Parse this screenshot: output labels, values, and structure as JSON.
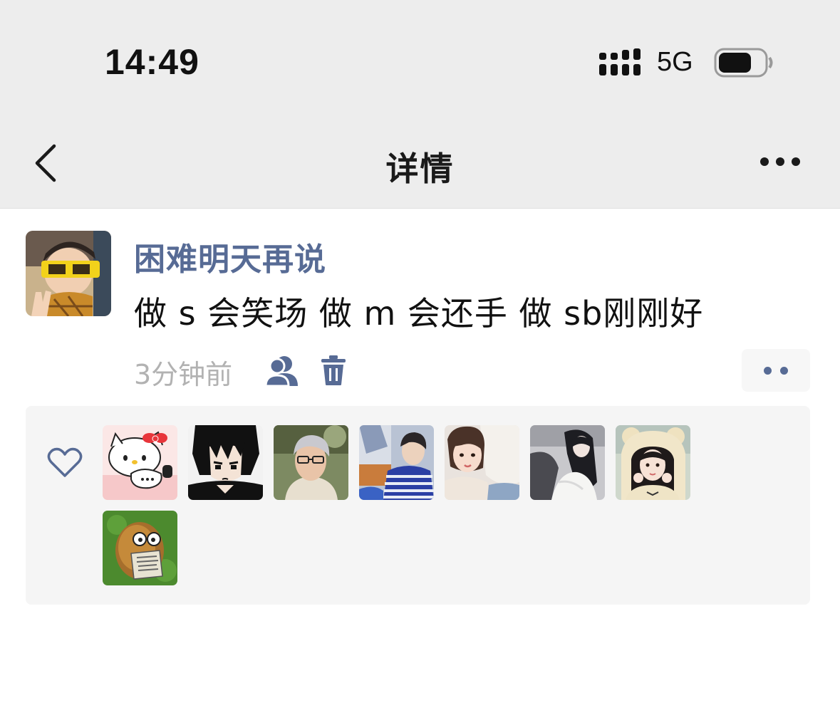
{
  "status_bar": {
    "time": "14:49",
    "network": "5G",
    "icons": [
      "signal-icon",
      "battery-icon"
    ]
  },
  "nav": {
    "title": "详情",
    "icons": [
      "back-icon",
      "more-icon"
    ]
  },
  "post": {
    "username": "困难明天再说",
    "text": "做 s 会笑场 做 m 会还手 做 sb刚刚好",
    "time": "3分钟前",
    "icons": [
      "friends-visible-icon",
      "delete-icon",
      "action-dots-icon"
    ],
    "colors": {
      "link": "#576b95",
      "meta": "#b2b2b2"
    }
  },
  "likes": {
    "icon": "heart-icon",
    "count": 8,
    "avatars": [
      "hello-kitty-avatar",
      "anime-boy-avatar",
      "silver-hair-man-avatar",
      "striped-shirt-boy-avatar",
      "girl-cheek-avatar",
      "long-hair-girl-avatar",
      "bear-hat-girl-avatar",
      "wall-nut-avatar"
    ]
  }
}
